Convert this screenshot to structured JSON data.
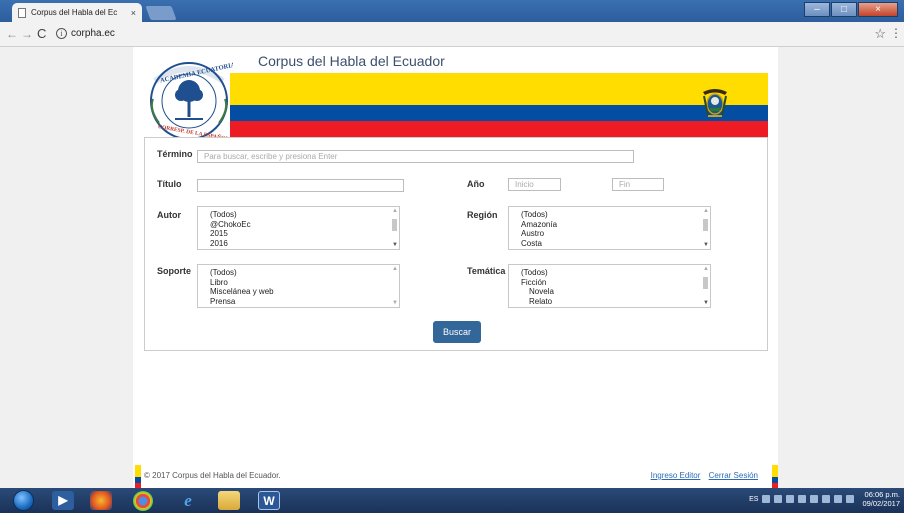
{
  "browser": {
    "tab_title": "Corpus del Habla del Ec",
    "tab_close": "×",
    "url": "corpha.ec",
    "icons": [
      "page-icon",
      "close-icon",
      "back-icon",
      "forward-icon",
      "reload-icon",
      "info-icon",
      "star-icon",
      "menu-icon"
    ]
  },
  "site": {
    "title": "Corpus del Habla del Ecuador",
    "seal_top": "ACADEMIA ECUATORIANA",
    "seal_bottom": "CORRESP. DE LA ESPAÑOLA",
    "flag_colors": {
      "yellow": "#ffdd00",
      "blue": "#034ea2",
      "red": "#ed1c24"
    }
  },
  "form": {
    "termino_label": "Término",
    "termino_placeholder": "Para buscar, escribe y presiona Enter",
    "titulo_label": "Título",
    "anio_label": "Año",
    "anio_inicio_placeholder": "Inicio",
    "anio_fin_placeholder": "Fin",
    "autor_label": "Autor",
    "autor_options": [
      "(Todos)",
      "@ChokoEc",
      "2015",
      "2016"
    ],
    "region_label": "Región",
    "region_options": [
      "(Todos)",
      "Amazonía",
      "Austro",
      "Costa"
    ],
    "soporte_label": "Soporte",
    "soporte_options": [
      "(Todos)",
      "Libro",
      "Miscelánea y web",
      "Prensa"
    ],
    "tematica_label": "Temática",
    "tematica_options": [
      "(Todos)",
      "Ficción",
      "Novela",
      "Relato"
    ],
    "search_button": "Buscar"
  },
  "footer": {
    "copyright": "© 2017 Corpus del Habla del Ecuador.",
    "link_editor": "Ingreso Editor",
    "link_logout": "Cerrar Sesión"
  },
  "taskbar": {
    "language": "ES",
    "time": "06:06 p.m.",
    "date": "09/02/2017",
    "apps": [
      "media-player-icon",
      "firefox-icon",
      "chrome-icon",
      "ie-icon",
      "folder-icon",
      "word-icon"
    ]
  }
}
